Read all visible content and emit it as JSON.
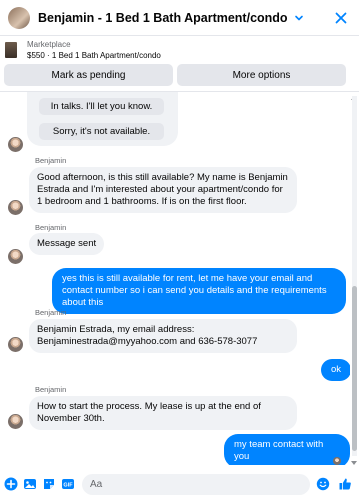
{
  "header": {
    "title": "Benjamin - 1 Bed 1 Bath Apartment/condo",
    "icons": [
      "avatar",
      "chevron-down-icon",
      "close-icon"
    ],
    "accent_color": "#0084ff"
  },
  "marketplace": {
    "label": "Marketplace",
    "listing": "$550 · 1 Bed 1 Bath Apartment/condo"
  },
  "actions": {
    "pending_label": "Mark as pending",
    "more_label": "More options"
  },
  "quick_replies": [
    "In talks. I'll let you know.",
    "Sorry, it's not available."
  ],
  "messages": [
    {
      "from": "Benjamin",
      "direction": "in",
      "text": "Good afternoon, is this still available?  My name is Benjamin Estrada and I'm interested about your apartment/condo for 1 bedroom and 1 bathrooms. If is on the first floor."
    },
    {
      "from": "Benjamin",
      "direction": "in",
      "text": "Message sent"
    },
    {
      "from": "me",
      "direction": "out",
      "text": "yes this is still available for rent, let me have your email  and contact number so i can send you details and the requirements about this"
    },
    {
      "from": "Benjamin",
      "direction": "in",
      "text": "Benjamin Estrada, my email address: Benjaminestrada@myyahoo.com and 636-578-3077"
    },
    {
      "from": "me",
      "direction": "out",
      "text": "ok"
    },
    {
      "from": "Benjamin",
      "direction": "in",
      "text": "How to start the process. My lease is up at the end of November 30th."
    },
    {
      "from": "me",
      "direction": "out",
      "text": "my team contact with you"
    }
  ],
  "composer": {
    "placeholder": "Aa",
    "icons": [
      "add-icon",
      "photo-icon",
      "sticker-icon",
      "gif-icon",
      "emoji-icon",
      "like-icon"
    ]
  }
}
